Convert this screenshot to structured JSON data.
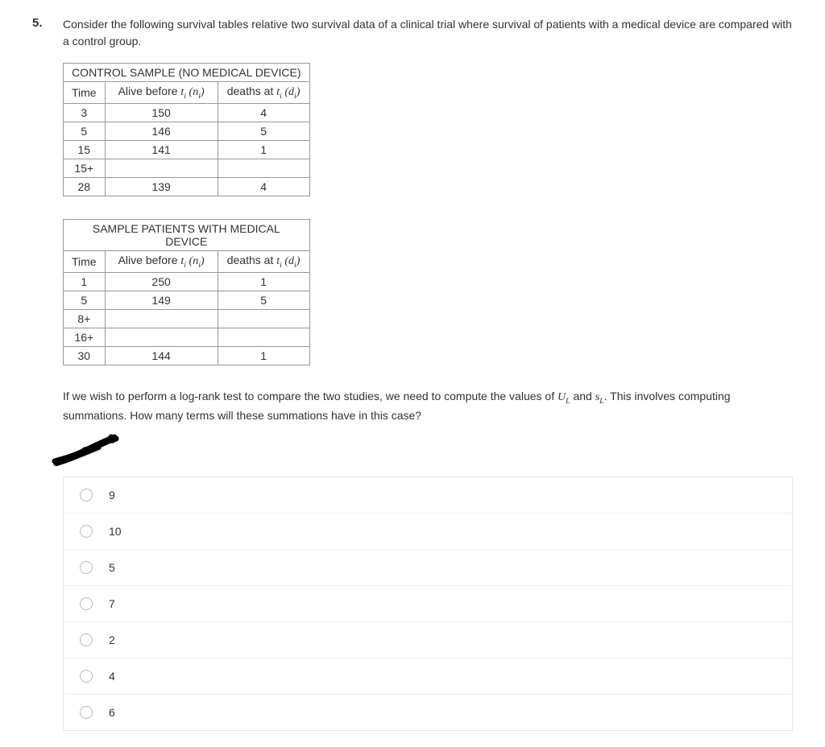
{
  "question": {
    "number": "5.",
    "text": "Consider the following survival tables relative two survival data of a clinical trial where survival of patients with  a medical device are compared with a control group."
  },
  "table1": {
    "title": "CONTROL SAMPLE (NO MEDICAL DEVICE)",
    "headers": {
      "time": "Time",
      "alive_prefix": "Alive before ",
      "alive_var": "t",
      "alive_sub": "i",
      "alive_paren": " (n",
      "alive_paren_sub": "i",
      "alive_close": ")",
      "deaths_prefix": "deaths at ",
      "deaths_var": "t",
      "deaths_sub": "i",
      "deaths_paren": " (d",
      "deaths_paren_sub": "i",
      "deaths_close": ")"
    },
    "rows": [
      {
        "time": "3",
        "alive": "150",
        "deaths": "4"
      },
      {
        "time": "5",
        "alive": "146",
        "deaths": "5"
      },
      {
        "time": "15",
        "alive": "141",
        "deaths": "1"
      },
      {
        "time": "15+",
        "alive": "",
        "deaths": ""
      },
      {
        "time": "28",
        "alive": "139",
        "deaths": "4"
      }
    ]
  },
  "table2": {
    "title": "SAMPLE PATIENTS WITH MEDICAL DEVICE",
    "headers": {
      "time": "Time",
      "alive_prefix": "Alive before ",
      "alive_var": "t",
      "alive_sub": "i",
      "alive_paren": " (n",
      "alive_paren_sub": "i",
      "alive_close": ")",
      "deaths_prefix": "deaths at ",
      "deaths_var": "t",
      "deaths_sub": "i",
      "deaths_paren": " (d",
      "deaths_paren_sub": "i",
      "deaths_close": ")"
    },
    "rows": [
      {
        "time": "1",
        "alive": "250",
        "deaths": "1"
      },
      {
        "time": "5",
        "alive": "149",
        "deaths": "5"
      },
      {
        "time": "8+",
        "alive": "",
        "deaths": ""
      },
      {
        "time": "16+",
        "alive": "",
        "deaths": ""
      },
      {
        "time": "30",
        "alive": "144",
        "deaths": "1"
      }
    ]
  },
  "followup": {
    "prefix": "If we wish to perform a log-rank test to compare the two studies, we need to compute the values of ",
    "ul_u": "U",
    "ul_l": "L",
    "and": " and ",
    "sl_s": "s",
    "sl_l": "L",
    "suffix": ". This involves computing summations. How many terms will these summations have in this case?"
  },
  "options": [
    {
      "label": "9"
    },
    {
      "label": "10"
    },
    {
      "label": "5"
    },
    {
      "label": "7"
    },
    {
      "label": "2"
    },
    {
      "label": "4"
    },
    {
      "label": "6"
    }
  ]
}
